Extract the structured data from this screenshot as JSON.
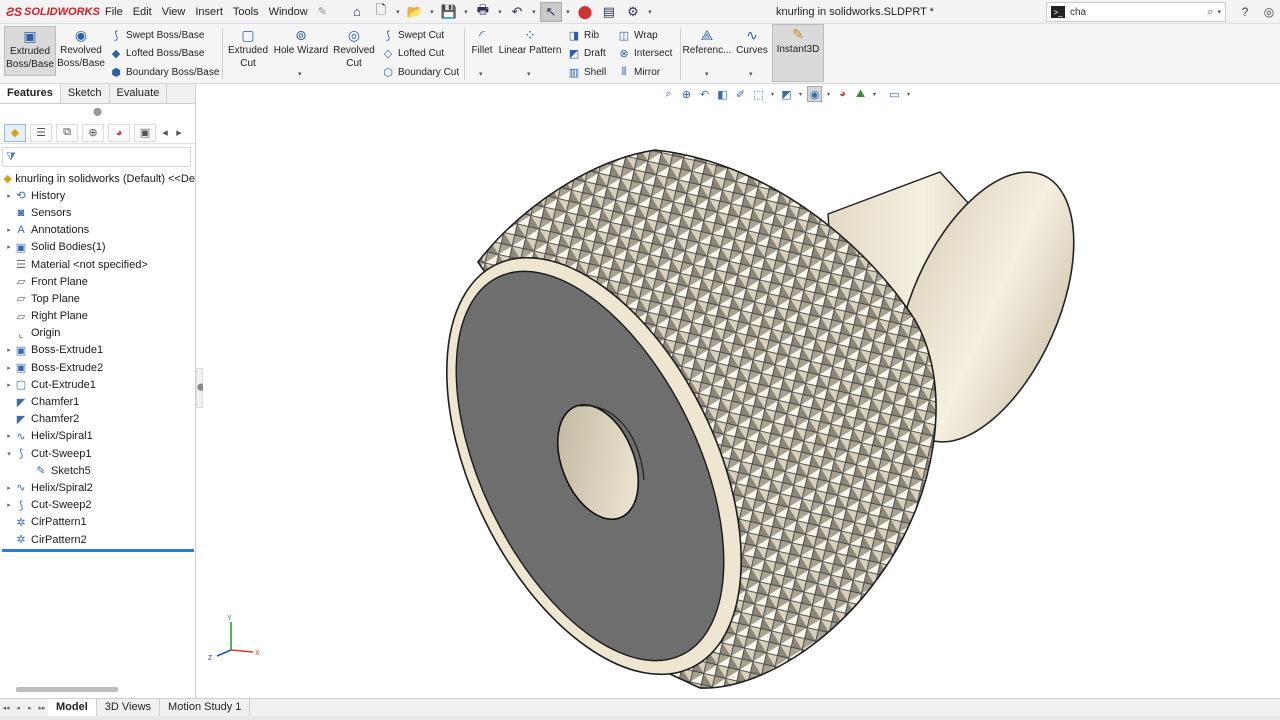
{
  "app": {
    "logo_text": "SOLIDWORKS",
    "document_title": "knurling in solidworks.SLDPRT *"
  },
  "menu": [
    "File",
    "Edit",
    "View",
    "Insert",
    "Tools",
    "Window"
  ],
  "search": {
    "value": "cha"
  },
  "ribbon": {
    "extruded_boss": "Extruded Boss/Base",
    "revolved_boss": "Revolved Boss/Base",
    "swept_boss": "Swept Boss/Base",
    "lofted_boss": "Lofted Boss/Base",
    "boundary_boss": "Boundary Boss/Base",
    "extruded_cut": "Extruded Cut",
    "hole_wizard": "Hole Wizard",
    "revolved_cut": "Revolved Cut",
    "swept_cut": "Swept Cut",
    "lofted_cut": "Lofted Cut",
    "boundary_cut": "Boundary Cut",
    "fillet": "Fillet",
    "linear_pattern": "Linear Pattern",
    "rib": "Rib",
    "draft": "Draft",
    "shell": "Shell",
    "wrap": "Wrap",
    "intersect": "Intersect",
    "mirror": "Mirror",
    "reference": "Referenc...",
    "curves": "Curves",
    "instant3d": "Instant3D"
  },
  "command_tabs": [
    "Features",
    "Sketch",
    "Evaluate"
  ],
  "tree": {
    "root": "knurling in solidworks (Default) <<De",
    "items": [
      {
        "label": "History",
        "expand": true,
        "icon": "history-icon"
      },
      {
        "label": "Sensors",
        "expand": false,
        "icon": "sensor-icon"
      },
      {
        "label": "Annotations",
        "expand": true,
        "icon": "annotation-icon"
      },
      {
        "label": "Solid Bodies(1)",
        "expand": true,
        "icon": "solid-body-icon"
      },
      {
        "label": "Material <not specified>",
        "expand": false,
        "icon": "material-icon"
      },
      {
        "label": "Front Plane",
        "expand": false,
        "icon": "plane-icon"
      },
      {
        "label": "Top Plane",
        "expand": false,
        "icon": "plane-icon"
      },
      {
        "label": "Right Plane",
        "expand": false,
        "icon": "plane-icon"
      },
      {
        "label": "Origin",
        "expand": false,
        "icon": "origin-icon"
      },
      {
        "label": "Boss-Extrude1",
        "expand": true,
        "icon": "extrude-icon"
      },
      {
        "label": "Boss-Extrude2",
        "expand": true,
        "icon": "extrude-icon"
      },
      {
        "label": "Cut-Extrude1",
        "expand": true,
        "icon": "cut-extrude-icon"
      },
      {
        "label": "Chamfer1",
        "expand": false,
        "icon": "chamfer-icon"
      },
      {
        "label": "Chamfer2",
        "expand": false,
        "icon": "chamfer-icon"
      },
      {
        "label": "Helix/Spiral1",
        "expand": true,
        "icon": "helix-icon"
      },
      {
        "label": "Cut-Sweep1",
        "expand": "open",
        "icon": "cut-sweep-icon"
      },
      {
        "label": "Sketch5",
        "expand": false,
        "icon": "sketch-icon",
        "child": true
      },
      {
        "label": "Helix/Spiral2",
        "expand": true,
        "icon": "helix-icon"
      },
      {
        "label": "Cut-Sweep2",
        "expand": true,
        "icon": "cut-sweep-icon"
      },
      {
        "label": "CirPattern1",
        "expand": false,
        "icon": "circular-pattern-icon"
      },
      {
        "label": "CirPattern2",
        "expand": false,
        "icon": "circular-pattern-icon"
      }
    ]
  },
  "triad": {
    "y": "Y",
    "x": "X",
    "z": "Z"
  },
  "bottom_tabs": [
    "Model",
    "3D Views",
    "Motion Study 1"
  ],
  "colors": {
    "accent": "#2f7bd1",
    "brand": "#d51f26",
    "part_body": "#efe6d2",
    "part_face": "#6e6e6e"
  }
}
